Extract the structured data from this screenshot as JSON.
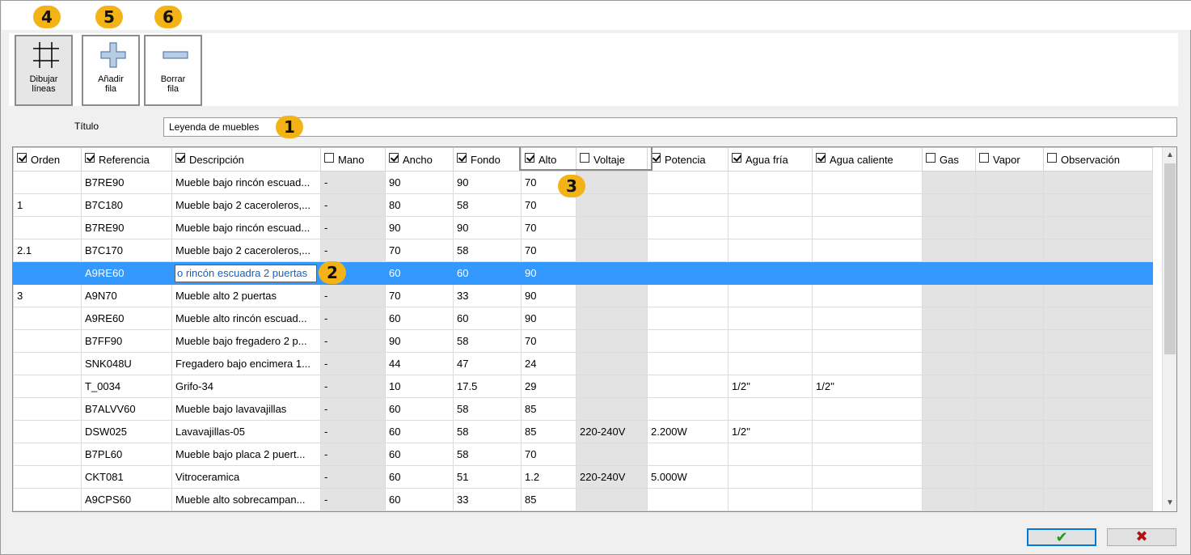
{
  "toolbar": {
    "draw_lines": {
      "line1": "Dibujar",
      "line2": "líneas",
      "icon": "grid-lines-icon"
    },
    "add_row": {
      "line1": "Añadir",
      "line2": "fila",
      "icon": "plus-icon"
    },
    "delete_row": {
      "line1": "Borrar",
      "line2": "fila",
      "icon": "minus-icon"
    }
  },
  "badges": [
    "1",
    "2",
    "3",
    "4",
    "5",
    "6"
  ],
  "title_field": {
    "label": "Título",
    "value": "Leyenda de muebles"
  },
  "columns": [
    {
      "key": "orden",
      "label": "Orden",
      "checked": true
    },
    {
      "key": "referencia",
      "label": "Referencia",
      "checked": true
    },
    {
      "key": "descripcion",
      "label": "Descripción",
      "checked": true
    },
    {
      "key": "mano",
      "label": "Mano",
      "checked": false
    },
    {
      "key": "ancho",
      "label": "Ancho",
      "checked": true
    },
    {
      "key": "fondo",
      "label": "Fondo",
      "checked": true
    },
    {
      "key": "alto",
      "label": "Alto",
      "checked": true
    },
    {
      "key": "voltaje",
      "label": "Voltaje",
      "checked": false
    },
    {
      "key": "potencia",
      "label": "Potencia",
      "checked": true
    },
    {
      "key": "agua_fria",
      "label": "Agua fría",
      "checked": true
    },
    {
      "key": "agua_caliente",
      "label": "Agua caliente",
      "checked": true
    },
    {
      "key": "gas",
      "label": "Gas",
      "checked": false
    },
    {
      "key": "vapor",
      "label": "Vapor",
      "checked": false
    },
    {
      "key": "observacion",
      "label": "Observación",
      "checked": false
    }
  ],
  "rows": [
    [
      "",
      "B7RE90",
      "Mueble bajo rincón escuad...",
      "-",
      "90",
      "90",
      "70",
      "",
      "",
      "",
      "",
      "",
      "",
      ""
    ],
    [
      "1",
      "B7C180",
      "Mueble bajo 2 caceroleros,...",
      "-",
      "80",
      "58",
      "70",
      "",
      "",
      "",
      "",
      "",
      "",
      ""
    ],
    [
      "",
      "B7RE90",
      "Mueble bajo rincón escuad...",
      "-",
      "90",
      "90",
      "70",
      "",
      "",
      "",
      "",
      "",
      "",
      ""
    ],
    [
      "2.1",
      "B7C170",
      "Mueble bajo 2 caceroleros,...",
      "-",
      "70",
      "58",
      "70",
      "",
      "",
      "",
      "",
      "",
      "",
      ""
    ],
    [
      "",
      "A9RE60",
      "o rincón escuadra 2 puertas",
      "",
      "60",
      "60",
      "90",
      "",
      "",
      "",
      "",
      "",
      "",
      ""
    ],
    [
      "3",
      "A9N70",
      "Mueble alto 2 puertas",
      "-",
      "70",
      "33",
      "90",
      "",
      "",
      "",
      "",
      "",
      "",
      ""
    ],
    [
      "",
      "A9RE60",
      "Mueble alto rincón escuad...",
      "-",
      "60",
      "60",
      "90",
      "",
      "",
      "",
      "",
      "",
      "",
      ""
    ],
    [
      "",
      "B7FF90",
      "Mueble bajo fregadero 2 p...",
      "-",
      "90",
      "58",
      "70",
      "",
      "",
      "",
      "",
      "",
      "",
      ""
    ],
    [
      "",
      "SNK048U",
      "Fregadero bajo encimera 1...",
      "-",
      "44",
      "47",
      "24",
      "",
      "",
      "",
      "",
      "",
      "",
      ""
    ],
    [
      "",
      "T_0034",
      "Grifo-34",
      "-",
      "10",
      "17.5",
      "29",
      "",
      "",
      "1/2''",
      "1/2''",
      "",
      "",
      ""
    ],
    [
      "",
      "B7ALVV60",
      "Mueble bajo lavavajillas",
      "-",
      "60",
      "58",
      "85",
      "",
      "",
      "",
      "",
      "",
      "",
      ""
    ],
    [
      "",
      "DSW025",
      "Lavavajillas-05",
      "-",
      "60",
      "58",
      "85",
      "220-240V",
      "2.200W",
      "1/2''",
      "",
      "",
      "",
      ""
    ],
    [
      "",
      "B7PL60",
      "Mueble bajo placa 2 puert...",
      "-",
      "60",
      "58",
      "70",
      "",
      "",
      "",
      "",
      "",
      "",
      ""
    ],
    [
      "",
      "CKT081",
      "Vitroceramica",
      "-",
      "60",
      "51",
      "1.2",
      "220-240V",
      "5.000W",
      "",
      "",
      "",
      "",
      ""
    ],
    [
      "",
      "A9CPS60",
      "Mueble alto sobrecampan...",
      "-",
      "60",
      "33",
      "85",
      "",
      "",
      "",
      "",
      "",
      "",
      ""
    ]
  ],
  "selected_row": 4,
  "editing_col": 2,
  "dialog_buttons": {
    "ok_glyph": "✔",
    "cancel_glyph": "✖"
  },
  "colors": {
    "selection": "#3399ff",
    "badge": "#f3b316",
    "disabled_col": "#e3e3e3"
  }
}
